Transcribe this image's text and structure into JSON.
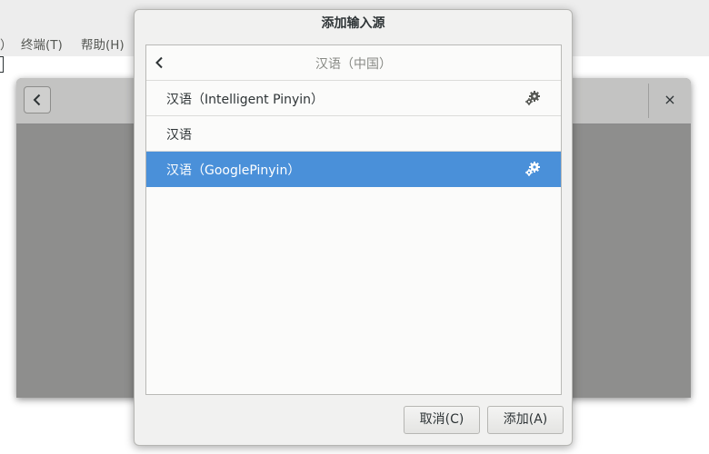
{
  "terminal": {
    "menu_fragment": "）",
    "menu_terminal": "终端(T)",
    "menu_help": "帮助(H)"
  },
  "settings_window": {
    "back_icon": "chevron-left-icon",
    "close_label": "×"
  },
  "dialog": {
    "title": "添加输入源",
    "list_header": "汉语（中国）",
    "items": [
      {
        "label": "汉语（Intelligent Pinyin）",
        "has_settings": true,
        "selected": false
      },
      {
        "label": "汉语",
        "has_settings": false,
        "selected": false
      },
      {
        "label": "汉语（GooglePinyin）",
        "has_settings": true,
        "selected": true
      }
    ],
    "cancel_label": "取消(C)",
    "add_label": "添加(A)"
  },
  "colors": {
    "selection": "#4a90d9",
    "dialog_bg": "#f1f1f0",
    "backdrop": "#8e8e8d"
  }
}
